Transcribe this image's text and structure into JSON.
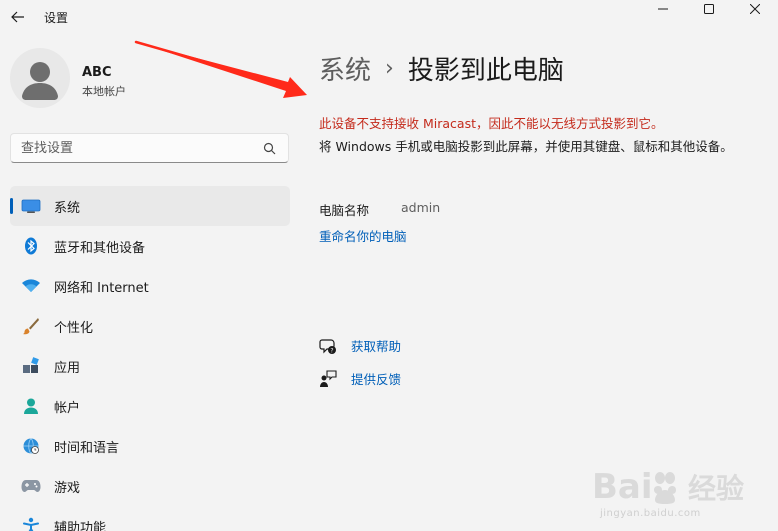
{
  "window": {
    "title": "设置"
  },
  "profile": {
    "name": "ABC",
    "account_type": "本地帐户"
  },
  "search": {
    "placeholder": "查找设置"
  },
  "sidebar": {
    "items": [
      {
        "label": "系统",
        "icon": "monitor-icon",
        "active": true
      },
      {
        "label": "蓝牙和其他设备",
        "icon": "bluetooth-icon"
      },
      {
        "label": "网络和 Internet",
        "icon": "wifi-icon"
      },
      {
        "label": "个性化",
        "icon": "paintbrush-icon"
      },
      {
        "label": "应用",
        "icon": "apps-icon"
      },
      {
        "label": "帐户",
        "icon": "person-icon"
      },
      {
        "label": "时间和语言",
        "icon": "globe-clock-icon"
      },
      {
        "label": "游戏",
        "icon": "gamepad-icon"
      },
      {
        "label": "辅助功能",
        "icon": "accessibility-icon"
      }
    ]
  },
  "main": {
    "breadcrumb_parent": "系统",
    "breadcrumb_separator": "›",
    "breadcrumb_current": "投影到此电脑",
    "error_message": "此设备不支持接收 Miracast，因此不能以无线方式投影到它。",
    "description": "将 Windows 手机或电脑投影到此屏幕，并使用其键盘、鼠标和其他设备。",
    "pc_name_label": "电脑名称",
    "pc_name_value": "admin",
    "rename_link": "重命名你的电脑",
    "help_link": "获取帮助",
    "feedback_link": "提供反馈"
  },
  "watermark": {
    "logo_text": "Bai 经验",
    "url": "jingyan.baidu.com"
  },
  "colors": {
    "accent": "#005fb8",
    "error": "#c42b1c",
    "annotation_arrow": "#ff2a1a",
    "background": "#f3f3f3"
  }
}
